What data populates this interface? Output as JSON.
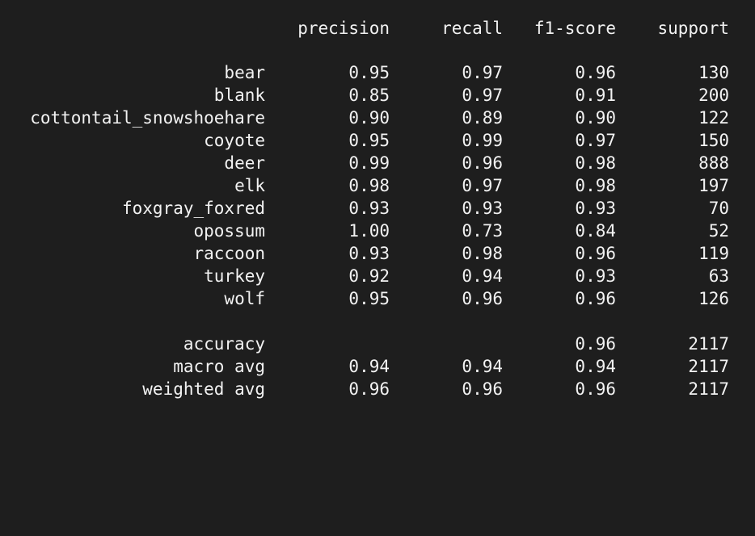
{
  "report": {
    "headers": {
      "precision": "precision",
      "recall": "recall",
      "f1": "f1-score",
      "support": "support"
    },
    "classes": [
      {
        "label": "bear",
        "precision": "0.95",
        "recall": "0.97",
        "f1": "0.96",
        "support": "130"
      },
      {
        "label": "blank",
        "precision": "0.85",
        "recall": "0.97",
        "f1": "0.91",
        "support": "200"
      },
      {
        "label": "cottontail_snowshoehare",
        "precision": "0.90",
        "recall": "0.89",
        "f1": "0.90",
        "support": "122"
      },
      {
        "label": "coyote",
        "precision": "0.95",
        "recall": "0.99",
        "f1": "0.97",
        "support": "150"
      },
      {
        "label": "deer",
        "precision": "0.99",
        "recall": "0.96",
        "f1": "0.98",
        "support": "888"
      },
      {
        "label": "elk",
        "precision": "0.98",
        "recall": "0.97",
        "f1": "0.98",
        "support": "197"
      },
      {
        "label": "foxgray_foxred",
        "precision": "0.93",
        "recall": "0.93",
        "f1": "0.93",
        "support": "70"
      },
      {
        "label": "opossum",
        "precision": "1.00",
        "recall": "0.73",
        "f1": "0.84",
        "support": "52"
      },
      {
        "label": "raccoon",
        "precision": "0.93",
        "recall": "0.98",
        "f1": "0.96",
        "support": "119"
      },
      {
        "label": "turkey",
        "precision": "0.92",
        "recall": "0.94",
        "f1": "0.93",
        "support": "63"
      },
      {
        "label": "wolf",
        "precision": "0.95",
        "recall": "0.96",
        "f1": "0.96",
        "support": "126"
      }
    ],
    "summary": [
      {
        "label": "accuracy",
        "precision": "",
        "recall": "",
        "f1": "0.96",
        "support": "2117"
      },
      {
        "label": "macro avg",
        "precision": "0.94",
        "recall": "0.94",
        "f1": "0.94",
        "support": "2117"
      },
      {
        "label": "weighted avg",
        "precision": "0.96",
        "recall": "0.96",
        "f1": "0.96",
        "support": "2117"
      }
    ]
  },
  "colors": {
    "background": "#1e1e1e",
    "text": "#f2f2f2"
  }
}
